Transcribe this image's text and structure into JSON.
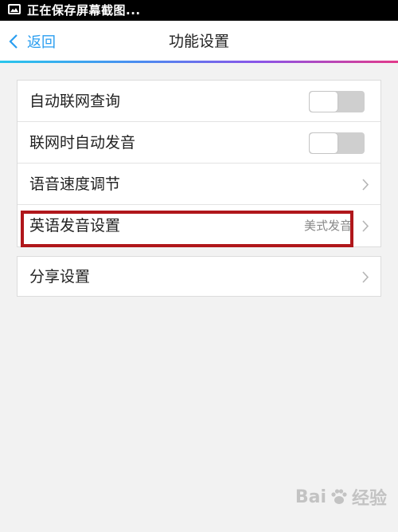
{
  "status_bar": {
    "text": "正在保存屏幕截图...",
    "icon": "screenshot-icon"
  },
  "nav": {
    "back_label": "返回",
    "title": "功能设置",
    "gradient_colors": [
      "#29c6ec",
      "#4b8cf0",
      "#8a55e8",
      "#e23a8a"
    ]
  },
  "settings": {
    "group1": [
      {
        "label": "自动联网查询",
        "control": "toggle",
        "on": false
      },
      {
        "label": "联网时自动发音",
        "control": "toggle",
        "on": false
      },
      {
        "label": "语音速度调节",
        "control": "chevron"
      },
      {
        "label": "英语发音设置",
        "value": "美式发音",
        "control": "chevron",
        "highlighted": true
      }
    ],
    "group2": [
      {
        "label": "分享设置",
        "control": "chevron"
      }
    ]
  },
  "highlight_color": "#b0171b",
  "accent_color": "#2a9ef0",
  "watermark": {
    "text_left": "Bai",
    "text_right": "经验"
  }
}
